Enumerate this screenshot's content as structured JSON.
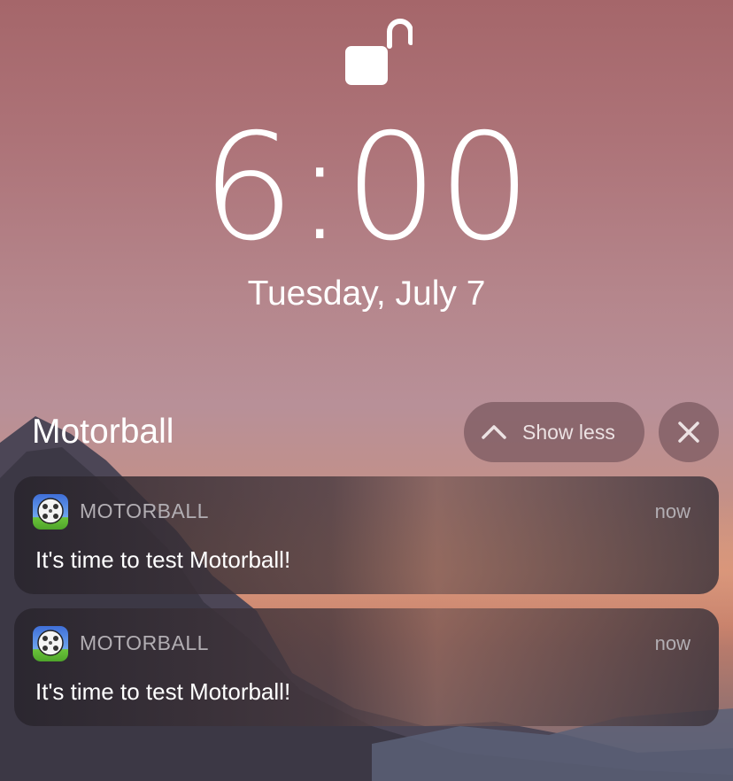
{
  "lockscreen": {
    "time": "6:00",
    "date": "Tuesday, July 7",
    "lock_icon": "unlocked-padlock-icon"
  },
  "group": {
    "title": "Motorball",
    "show_less_label": "Show less",
    "show_less_icon": "chevron-up-icon",
    "close_icon": "close-icon"
  },
  "notifications": [
    {
      "app_name": "MOTORBALL",
      "time": "now",
      "message": "It's time to test Motorball!",
      "icon": "motorball-app-icon"
    },
    {
      "app_name": "MOTORBALL",
      "time": "now",
      "message": "It's time to test Motorball!",
      "icon": "motorball-app-icon"
    }
  ],
  "colors": {
    "sky_top": "#a5666a",
    "sky_glow": "#c9907f",
    "card_dark": "#28242c",
    "secondary_text": "#b2aeb3"
  }
}
